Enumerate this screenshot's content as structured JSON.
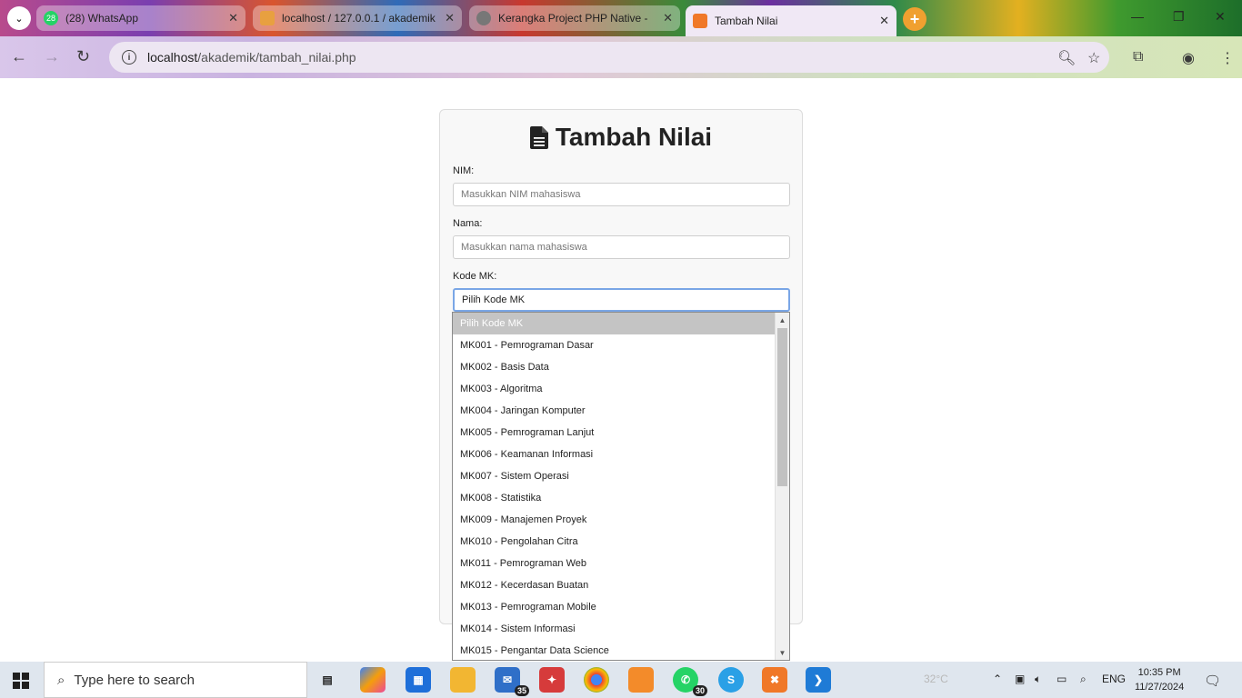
{
  "browser": {
    "tabs": [
      {
        "title": "(28) WhatsApp",
        "favicon_badge": "28"
      },
      {
        "title": "localhost / 127.0.0.1 / akademik",
        "favicon_badge": ""
      },
      {
        "title": "Kerangka Project PHP Native - ",
        "favicon_badge": ""
      },
      {
        "title": "Tambah Nilai",
        "favicon_badge": ""
      }
    ],
    "address": {
      "host": "localhost",
      "path": "/akademik/tambah_nilai.php"
    }
  },
  "page": {
    "title": "Tambah Nilai",
    "nim": {
      "label": "NIM:",
      "placeholder": "Masukkan NIM mahasiswa"
    },
    "nama": {
      "label": "Nama:",
      "placeholder": "Masukkan nama mahasiswa"
    },
    "kode_mk": {
      "label": "Kode MK:",
      "selected": "Pilih Kode MK",
      "options": [
        "Pilih Kode MK",
        "MK001 - Pemrograman Dasar",
        "MK002 - Basis Data",
        "MK003 - Algoritma",
        "MK004 - Jaringan Komputer",
        "MK005 - Pemrograman Lanjut",
        "MK006 - Keamanan Informasi",
        "MK007 - Sistem Operasi",
        "MK008 - Statistika",
        "MK009 - Manajemen Proyek",
        "MK010 - Pengolahan Citra",
        "MK011 - Pemrograman Web",
        "MK012 - Kecerdasan Buatan",
        "MK013 - Pemrograman Mobile",
        "MK014 - Sistem Informasi",
        "MK015 - Pengantar Data Science"
      ]
    }
  },
  "taskbar": {
    "search_placeholder": "Type here to search",
    "mail_badge": "35",
    "whatsapp_badge": "30",
    "weather": "32°C",
    "language": "ENG",
    "time": "10:35 PM",
    "date": "11/27/2024"
  }
}
